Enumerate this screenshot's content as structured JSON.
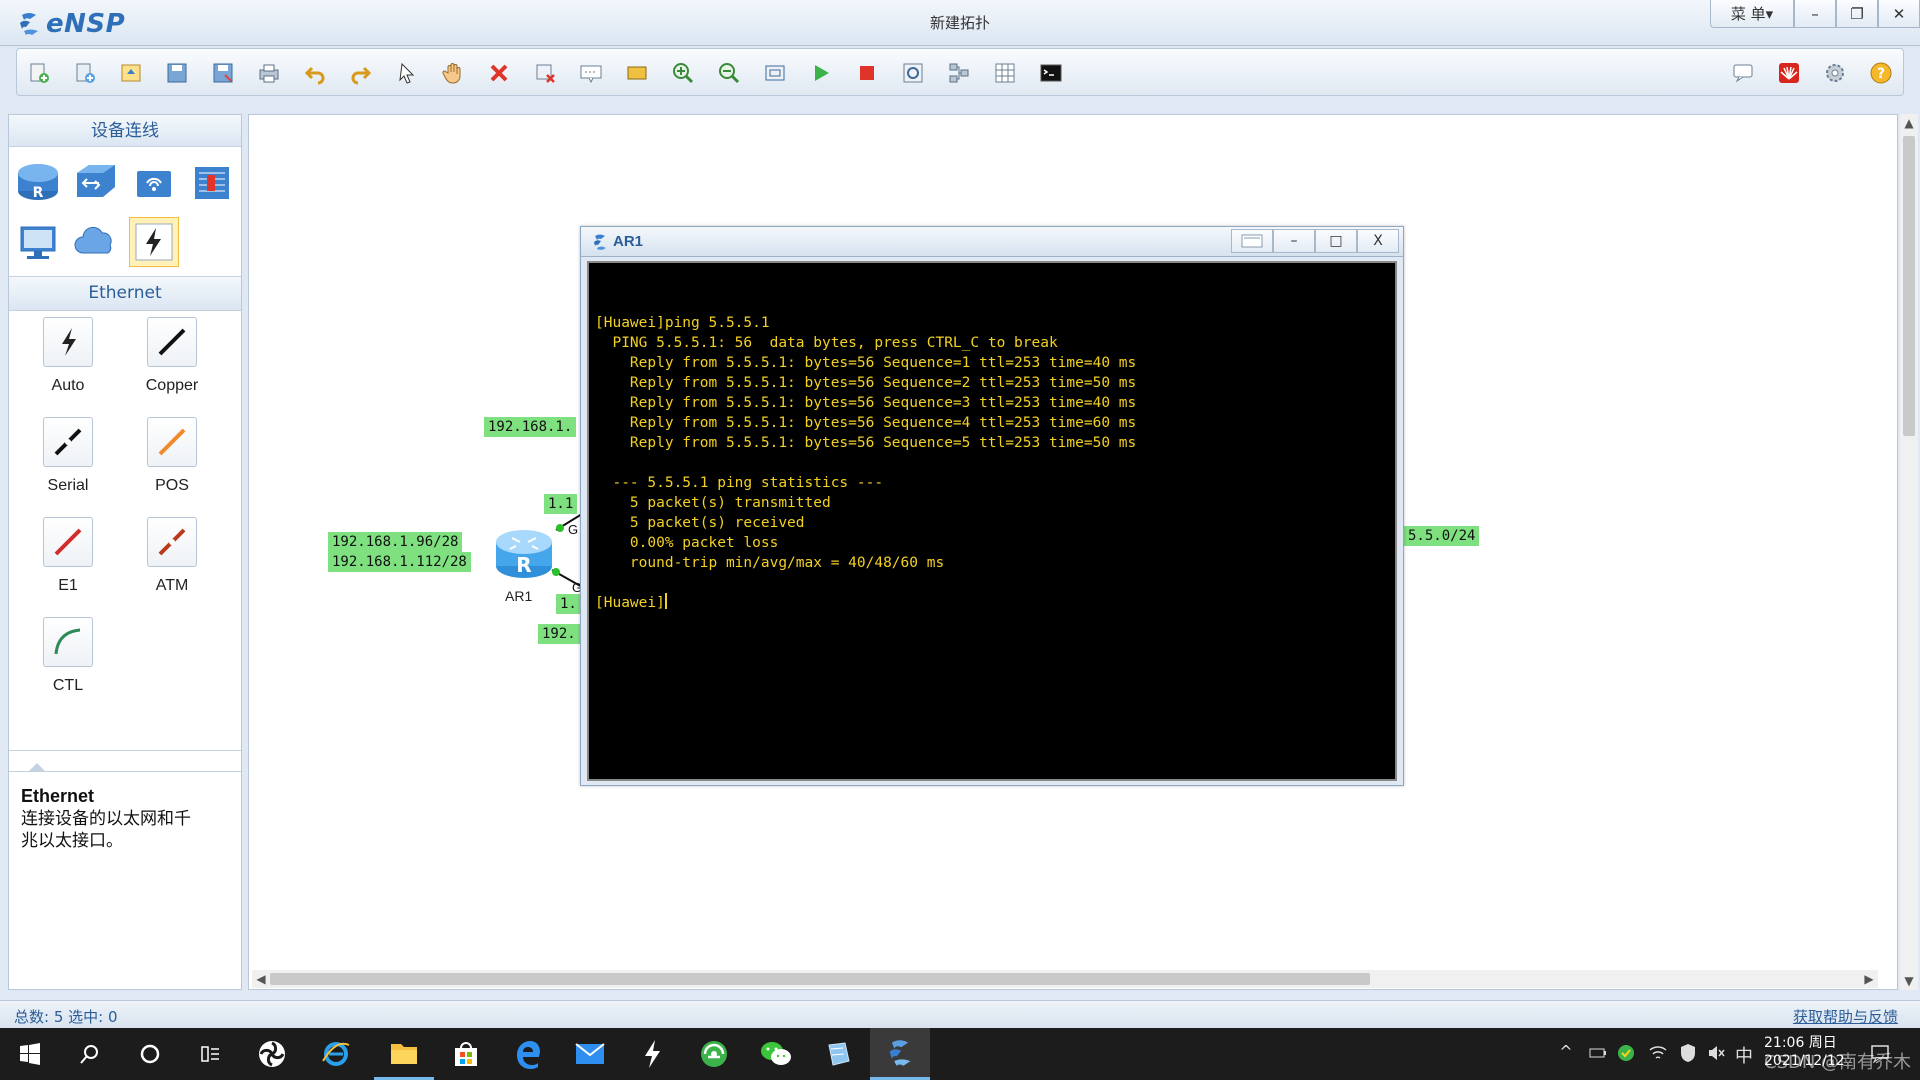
{
  "app": {
    "name": "eNSP",
    "window_title": "新建拓扑",
    "menu_label": "菜 单▾",
    "minimize": "–",
    "restore": "❐",
    "close": "✕"
  },
  "toolbar": {
    "icons": [
      "new-topology-icon",
      "new-lab-icon",
      "open-icon",
      "save-icon",
      "save-as-icon",
      "print-icon",
      "undo-icon",
      "redo-icon",
      "select-icon",
      "pan-hand-icon",
      "delete-icon",
      "delete-link-icon",
      "text-note-icon",
      "rectangle-icon",
      "zoom-in-icon",
      "zoom-out-icon",
      "fit-view-icon",
      "start-device-icon",
      "stop-device-icon",
      "capture-icon",
      "topology-icon",
      "grid-icon",
      "cli-icon"
    ],
    "right_icons": [
      "chat-icon",
      "huawei-icon",
      "settings-icon",
      "help-icon"
    ]
  },
  "left_panel": {
    "devices_header": "设备连线",
    "devices": [
      "router",
      "switch",
      "wlan",
      "firewall",
      "pc",
      "cloud",
      "cable"
    ],
    "ethernet_header": "Ethernet",
    "cables": [
      {
        "label": "Auto",
        "color": "#222222"
      },
      {
        "label": "Copper",
        "color": "#111111"
      },
      {
        "label": "Serial",
        "color": "#111111"
      },
      {
        "label": "POS",
        "color": "#f08a2a"
      },
      {
        "label": "E1",
        "color": "#d22b2b"
      },
      {
        "label": "ATM",
        "color": "#b83a1a"
      },
      {
        "label": "CTL",
        "color": "#2e8b57"
      }
    ],
    "desc_title": "Ethernet",
    "desc_text_line1": "连接设备的以太网和千",
    "desc_text_line2": "兆以太接口。"
  },
  "canvas": {
    "labels": {
      "net_top": "192.168.1.",
      "net_left_1": "192.168.1.96/28",
      "net_left_2": "192.168.1.112/28",
      "link_top": "1.1",
      "link_bottom": "1.",
      "net_bottom": "192.",
      "net_right": "5.5.0/24",
      "port_top": "G",
      "port_bottom": "G"
    },
    "router_label": "AR1"
  },
  "console": {
    "title": "AR1",
    "lines": [
      "[Huawei]ping 5.5.5.1",
      "  PING 5.5.5.1: 56  data bytes, press CTRL_C to break",
      "    Reply from 5.5.5.1: bytes=56 Sequence=1 ttl=253 time=40 ms",
      "    Reply from 5.5.5.1: bytes=56 Sequence=2 ttl=253 time=50 ms",
      "    Reply from 5.5.5.1: bytes=56 Sequence=3 ttl=253 time=40 ms",
      "    Reply from 5.5.5.1: bytes=56 Sequence=4 ttl=253 time=60 ms",
      "    Reply from 5.5.5.1: bytes=56 Sequence=5 ttl=253 time=50 ms",
      "",
      "  --- 5.5.5.1 ping statistics ---",
      "    5 packet(s) transmitted",
      "    5 packet(s) received",
      "    0.00% packet loss",
      "    round-trip min/avg/max = 40/48/60 ms",
      ""
    ],
    "prompt": "[Huawei]"
  },
  "statusbar": {
    "left": "总数: 5  选中: 0",
    "right": "获取帮助与反馈"
  },
  "taskbar": {
    "apps": [
      "start-icon",
      "search-icon",
      "cortana-icon",
      "task-view-icon",
      "app-s-icon",
      "ie-icon",
      "file-explorer-icon",
      "store-icon",
      "edge-icon",
      "mail-icon",
      "lightning-app-icon",
      "browser-360-icon",
      "wechat-icon",
      "virtualbox-icon",
      "ensp-icon"
    ],
    "tray_ime": "中",
    "clock_time": "21:06 周日",
    "clock_date": "2021/12/12",
    "watermark": "CSDN @南有乔木"
  }
}
